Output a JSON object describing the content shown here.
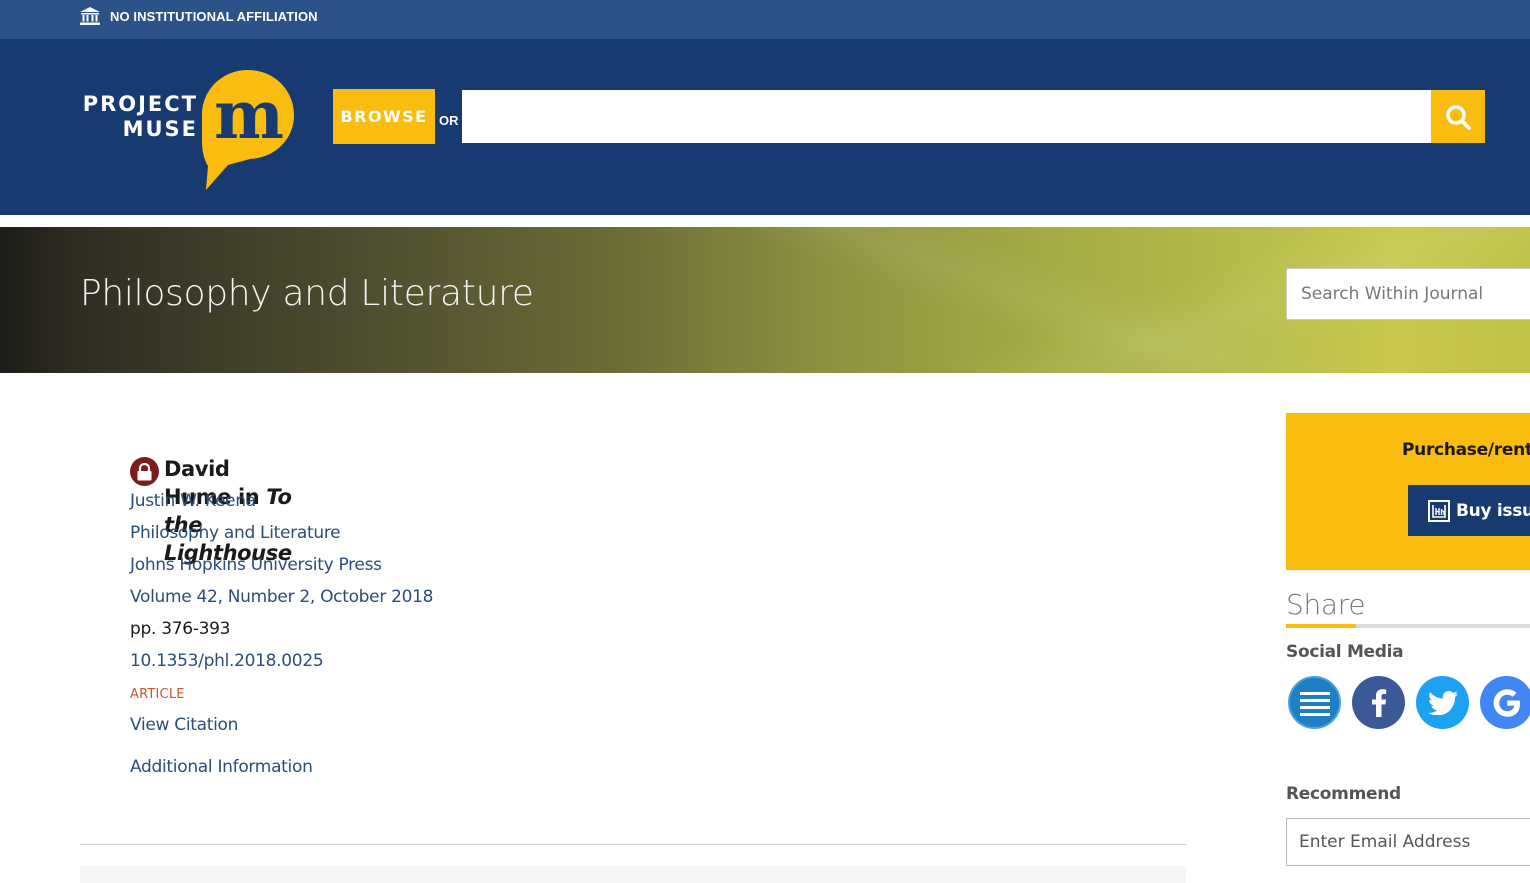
{
  "affiliation": {
    "text": "NO INSTITUTIONAL AFFILIATION",
    "icon": "institution-icon"
  },
  "header": {
    "logo_line1": "PROJECT",
    "logo_line2": "MUSE",
    "logo_mark": "m",
    "browse_label": "BROWSE",
    "or_label": "OR",
    "search_value": "",
    "search_icon": "search-icon"
  },
  "journal": {
    "title": "Philosophy and Literature",
    "search_placeholder": "Search Within Journal"
  },
  "article": {
    "title_plain": "David Hume in ",
    "title_italic": "To the Lighthouse",
    "author": "Justin W. Keena",
    "journal": "Philosophy and Literature",
    "publisher": "Johns Hopkins University Press",
    "issue": "Volume 42, Number 2, October 2018",
    "pages": "pp. 376-393",
    "doi": "10.1353/phl.2018.0025",
    "type": "ARTICLE",
    "view_citation": "View Citation",
    "additional_info": "Additional Information"
  },
  "sidebar": {
    "purchase_title": "Purchase/renta",
    "buy_label": "Buy issue",
    "share_heading": "Share",
    "social_label": "Social Media",
    "recommend_label": "Recommend",
    "email_placeholder": "Enter Email Address",
    "social_icons": [
      "share-list-icon",
      "facebook-icon",
      "twitter-icon",
      "google-icon"
    ]
  },
  "colors": {
    "top_bar": "#2b5289",
    "header": "#173b70",
    "accent_yellow": "#fbbc10",
    "link_blue": "#2b4d7a",
    "article_tag": "#d35427",
    "lock_red": "#7a1d1d"
  }
}
